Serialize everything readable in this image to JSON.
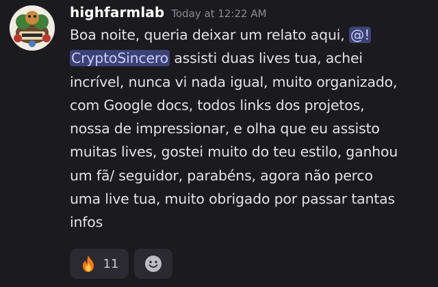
{
  "message": {
    "username": "highfarmlab",
    "timestamp": "Today at 12:22 AM",
    "lines": [
      {
        "before": "Boa noite, queria deixar um relato aqui, ",
        "mention": "@!"
      },
      {
        "mention": "CryptoSincero",
        "after": " assisti duas lives tua, achei"
      },
      {
        "text": "incrível, nunca vi nada igual, muito organizado,"
      },
      {
        "text": "com Google docs, todos links dos projetos,"
      },
      {
        "text": "nossa de impressionar, e olha que eu assisto"
      },
      {
        "text": "muitas lives, gostei muito do teu estilo, ganhou"
      },
      {
        "text": "um fã/ seguidor, parabéns, agora não perco"
      },
      {
        "text": "uma live tua, muito obrigado por passar tantas"
      },
      {
        "text": "infos"
      }
    ]
  },
  "reactions": [
    {
      "icon": "fire-icon",
      "count": "11"
    },
    {
      "icon": "add-reaction-smile-icon"
    }
  ],
  "colors": {
    "background": "#1b1a1e",
    "mention_bg": "#3c4275",
    "mention_text": "#c9cdff",
    "reaction_bg": "#2b2a32"
  }
}
